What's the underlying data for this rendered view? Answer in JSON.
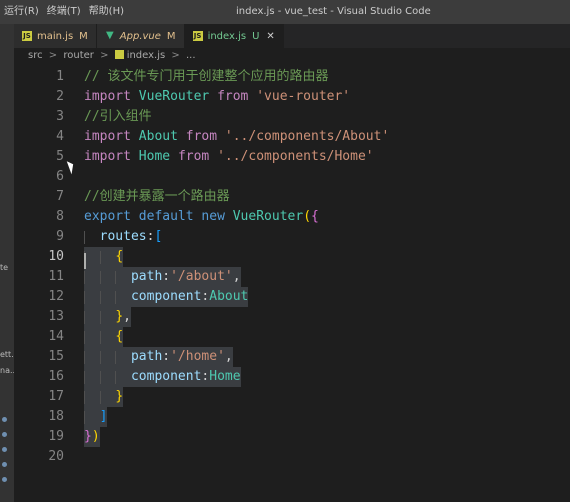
{
  "menu": [
    "运行(R)",
    "终端(T)",
    "帮助(H)"
  ],
  "window_title": "index.js - vue_test - Visual Studio Code",
  "tabs": [
    {
      "name": "main.js",
      "status": "M",
      "icon": "js-icon"
    },
    {
      "name": "App.vue",
      "status": "M",
      "icon": "vue-icon"
    },
    {
      "name": "index.js",
      "status": "U",
      "icon": "js-icon",
      "active": true
    }
  ],
  "close_glyph": "✕",
  "breadcrumb": {
    "parts": [
      "src",
      "router",
      "index.js",
      "..."
    ],
    "sep": ">"
  },
  "side_fragments": [
    "te",
    "ett...",
    "na..."
  ],
  "current_line": 10,
  "lines": [
    {
      "n": "1",
      "text": "// 该文件专门用于创建整个应用的路由器"
    },
    {
      "n": "2",
      "text": "import VueRouter from 'vue-router'"
    },
    {
      "n": "3",
      "text": "//引入组件"
    },
    {
      "n": "4",
      "text": "import About from '../components/About'"
    },
    {
      "n": "5",
      "text": "import Home from '../components/Home'"
    },
    {
      "n": "6",
      "text": ""
    },
    {
      "n": "7",
      "text": "//创建并暴露一个路由器"
    },
    {
      "n": "8",
      "text": "export default new VueRouter({"
    },
    {
      "n": "9",
      "text": "  routes:["
    },
    {
      "n": "10",
      "text": "    {"
    },
    {
      "n": "11",
      "text": "      path:'/about',"
    },
    {
      "n": "12",
      "text": "      component:About"
    },
    {
      "n": "13",
      "text": "    },"
    },
    {
      "n": "14",
      "text": "    {"
    },
    {
      "n": "15",
      "text": "      path:'/home',"
    },
    {
      "n": "16",
      "text": "      component:Home"
    },
    {
      "n": "17",
      "text": "    }"
    },
    {
      "n": "18",
      "text": "  ]"
    },
    {
      "n": "19",
      "text": "})"
    },
    {
      "n": "20",
      "text": ""
    }
  ],
  "colors": {
    "background": "#1e1e1e",
    "keyword": "#569cd6",
    "import_keyword": "#c586c0",
    "class": "#4ec9b0",
    "string": "#ce9178",
    "comment": "#6a9955",
    "property": "#9cdcfe",
    "selection": "#3a3d41"
  }
}
